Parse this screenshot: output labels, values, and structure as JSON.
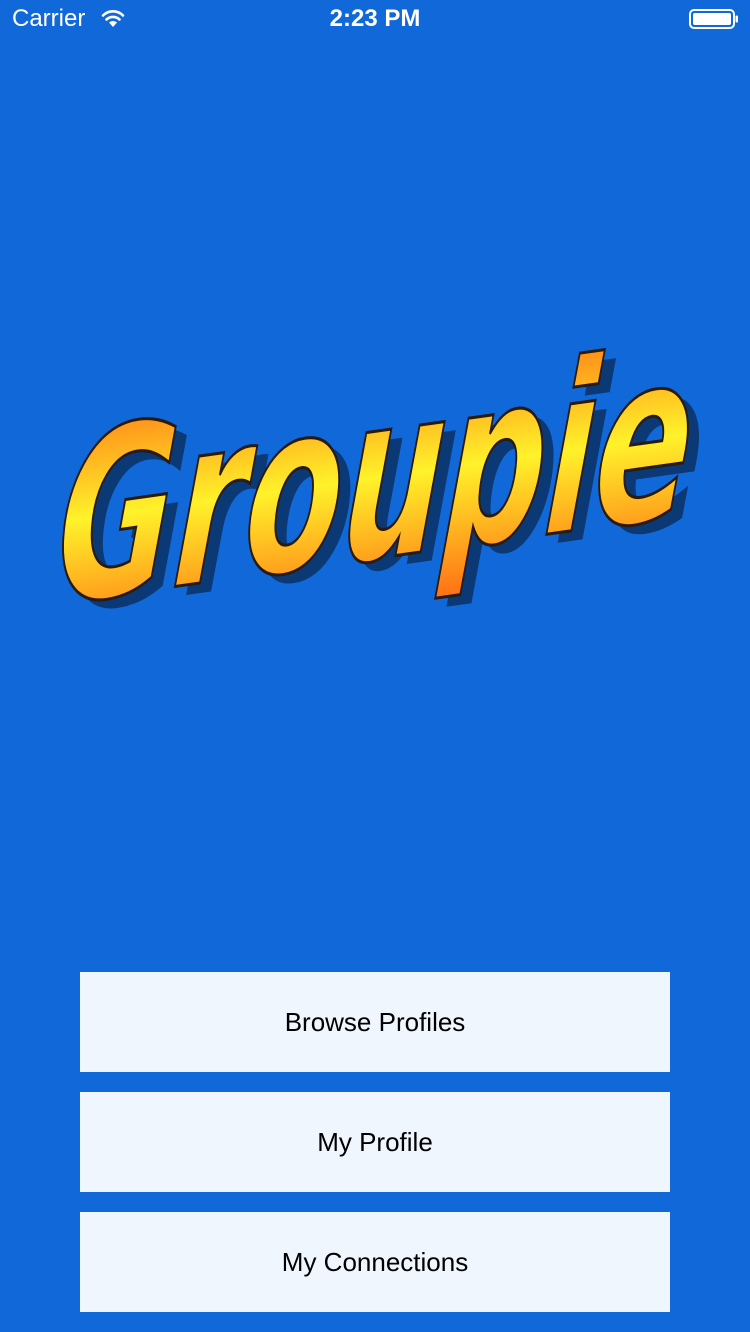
{
  "status_bar": {
    "carrier": "Carrier",
    "time": "2:23 PM",
    "wifi_icon": "wifi-icon",
    "battery_icon": "battery-full-icon"
  },
  "logo": {
    "text": "Groupie",
    "colors": {
      "gradient_top": "#ff6a14",
      "gradient_mid": "#fff22a",
      "gradient_bottom": "#ff6a14",
      "outline": "#2a1a10"
    }
  },
  "menu": {
    "browse_profiles": "Browse Profiles",
    "my_profile": "My Profile",
    "my_connections": "My Connections"
  },
  "colors": {
    "background": "#1169d9",
    "button_background": "#eff6fd",
    "button_text": "#000000"
  }
}
